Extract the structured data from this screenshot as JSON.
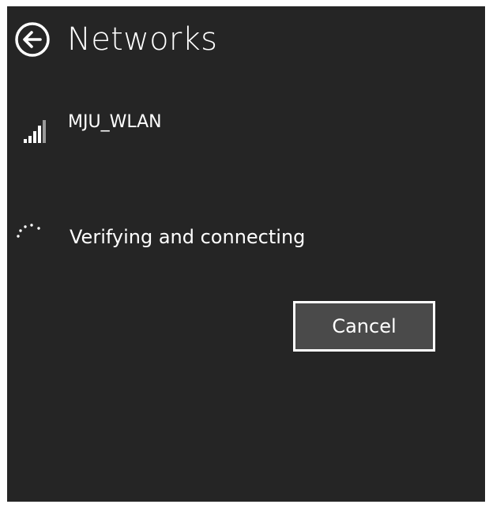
{
  "header": {
    "title": "Networks",
    "back_icon": "back-arrow-circle-icon"
  },
  "network": {
    "name": "MJU_WLAN",
    "signal_icon": "wifi-signal-strength-icon",
    "signal_bars_filled": 4,
    "signal_bars_total": 5
  },
  "status": {
    "text": "Verifying and connecting",
    "spinner_icon": "progress-dots-icon"
  },
  "actions": {
    "cancel_label": "Cancel"
  },
  "colors": {
    "background": "#252525",
    "foreground": "#ffffff",
    "button_fill": "#4a4a4a",
    "signal_inactive": "#9a9a9a"
  }
}
